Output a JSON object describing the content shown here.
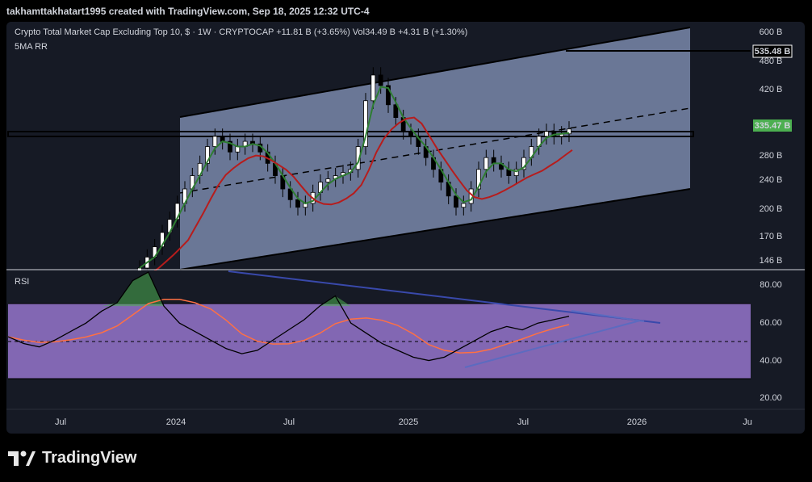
{
  "header": {
    "credit": "takhamttakhatart1995 created with TradingView.com, Sep 18, 2025 12:32 UTC-4"
  },
  "legend": {
    "symbol_line": "Crypto Total Market Cap Excluding Top 10, $ · 1W · CRYPTOCAP  +11.81 B (+3.65%)  Vol34.49 B  +4.31 B (+1.30%)",
    "ma_line": "5MA RR"
  },
  "rsi_panel": {
    "label": "RSI"
  },
  "price_axis": {
    "ticks": [
      "600 B",
      "480 B",
      "420 B",
      "280 B",
      "240 B",
      "200 B",
      "170 B",
      "146 B"
    ],
    "tag_level": "535.48 B",
    "tag_price": "335.47 B"
  },
  "rsi_axis": {
    "ticks": [
      "80.00",
      "60.00",
      "40.00",
      "20.00"
    ]
  },
  "time_axis": {
    "ticks": [
      "Jul",
      "2024",
      "Jul",
      "2025",
      "Jul",
      "2026",
      "Ju"
    ]
  },
  "brand": {
    "name": "TradingView"
  },
  "colors": {
    "channel_fill": "#8fa0c6",
    "up_candle": "#ffffff",
    "down_candle": "#000000",
    "ma_fast": "#2e7d32",
    "ma_slow": "#b71c1c",
    "rsi_band": "#9575cd",
    "rsi_line": "#000000",
    "rsi_ma": "#ff7043",
    "trend_blue": "#3949ab",
    "price_tag": "#4caf50"
  },
  "chart_data": {
    "type": "candlestick",
    "price_series_approx_close_billions": [
      140,
      150,
      160,
      175,
      190,
      210,
      230,
      250,
      270,
      300,
      320,
      310,
      290,
      300,
      310,
      305,
      290,
      270,
      250,
      230,
      215,
      205,
      210,
      225,
      240,
      245,
      250,
      255,
      260,
      300,
      400,
      470,
      440,
      390,
      360,
      330,
      320,
      300,
      280,
      260,
      240,
      220,
      205,
      210,
      230,
      260,
      280,
      270,
      260,
      250,
      260,
      280,
      300,
      320,
      330,
      320,
      325,
      335
    ],
    "rsi_series_approx": [
      52,
      48,
      46,
      50,
      55,
      60,
      67,
      72,
      85,
      90,
      70,
      60,
      55,
      50,
      45,
      42,
      44,
      50,
      56,
      62,
      70,
      76,
      60,
      54,
      48,
      44,
      40,
      38,
      40,
      45,
      50,
      55,
      58,
      56,
      60,
      62,
      64
    ],
    "levels": {
      "horizontal_zone_billions": 335,
      "tag_level_billions": 535.48,
      "last_price_billions": 335.47
    },
    "rsi_bands": {
      "upper": 70,
      "middle": 50,
      "lower": 30
    },
    "ylim_price_billions": [
      140,
      640
    ],
    "ylim_rsi": [
      15,
      90
    ]
  }
}
